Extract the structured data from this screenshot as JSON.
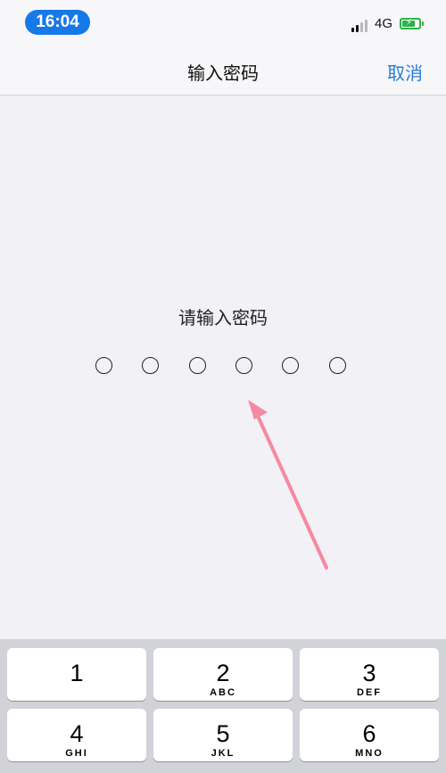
{
  "status_bar": {
    "time": "16:04",
    "network": "4G",
    "battery_level": 0.8,
    "signal_bars_active": 2,
    "colors": {
      "time_pill": "#1679e8",
      "battery": "#2fb24a"
    }
  },
  "nav": {
    "title": "输入密码",
    "cancel_label": "取消",
    "cancel_color": "#2a7bd8"
  },
  "passcode": {
    "prompt": "请输入密码",
    "length": 6,
    "entered": 0
  },
  "annotation": {
    "type": "pointer-arrow",
    "color": "#f48aa0",
    "target": "passcode-dot-4"
  },
  "keypad": {
    "keys": [
      {
        "digit": "1",
        "letters": ""
      },
      {
        "digit": "2",
        "letters": "ABC"
      },
      {
        "digit": "3",
        "letters": "DEF"
      },
      {
        "digit": "4",
        "letters": "GHI"
      },
      {
        "digit": "5",
        "letters": "JKL"
      },
      {
        "digit": "6",
        "letters": "MNO"
      }
    ]
  }
}
